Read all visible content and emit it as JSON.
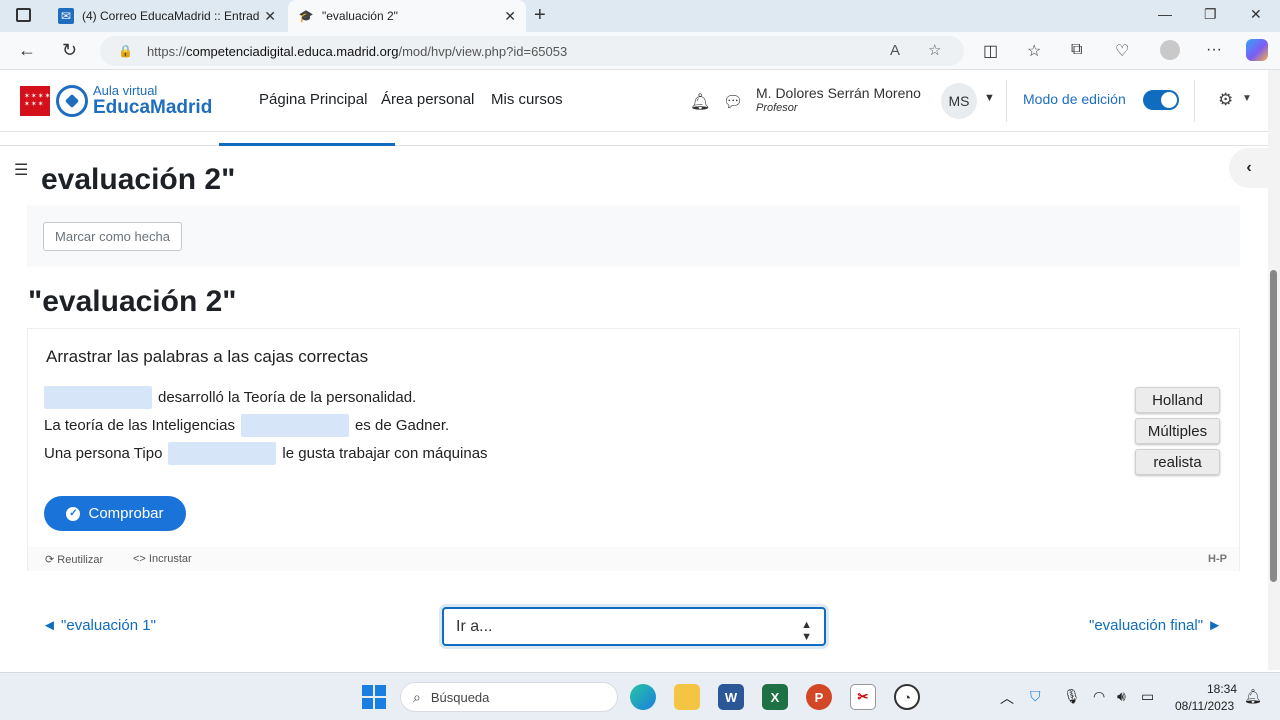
{
  "browser": {
    "tabs": [
      {
        "title": "(4) Correo EducaMadrid :: Entrad",
        "icon": "mail-icon"
      },
      {
        "title": "\"evaluación 2\"",
        "icon": "graduation-cap-icon"
      }
    ],
    "url_scheme": "https://",
    "url_host": "competenciadigital.educa.madrid.org",
    "url_path": "/mod/hvp/view.php?id=65053"
  },
  "site": {
    "logo_line1": "Aula virtual",
    "logo_line2": "EducaMadrid",
    "nav": [
      "Página Principal",
      "Área personal",
      "Mis cursos"
    ],
    "user_name": "M. Dolores Serrán Moreno",
    "user_role": "Profesor",
    "user_initials": "MS",
    "edit_mode_label": "Modo de edición",
    "edit_mode_on": true
  },
  "page": {
    "title_top": "evaluación 2\"",
    "mark_done_label": "Marcar como hecha",
    "activity_title": "\"evaluación 2\""
  },
  "h5p": {
    "instruction": "Arrastrar las palabras a las cajas correctas",
    "sentences": [
      {
        "before": "",
        "after": "desarrolló la Teoría de la personalidad."
      },
      {
        "before": "La teoría de las Inteligencias",
        "after": "es de Gadner."
      },
      {
        "before": "Una persona Tipo",
        "after": "le gusta trabajar con máquinas"
      }
    ],
    "words": [
      "Holland",
      "Múltiples",
      "realista"
    ],
    "check_label": "Comprobar",
    "reuse_label": "Reutilizar",
    "embed_label": "Incrustar",
    "brand": "H-P"
  },
  "navigation": {
    "prev_label": "\"evaluación 1\"",
    "next_label": "\"evaluación final\"",
    "jump_placeholder": "Ir a..."
  },
  "taskbar": {
    "search_placeholder": "Búsqueda",
    "time": "18:34",
    "date": "08/11/2023"
  },
  "colors": {
    "accent": "#0f6cbf",
    "check_button": "#1a73d9",
    "dropzone": "#d6e6f8",
    "brand_red": "#d4111b"
  }
}
